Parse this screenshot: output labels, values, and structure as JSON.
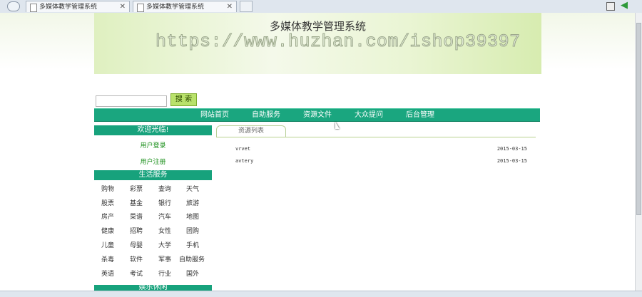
{
  "browser": {
    "tabs": [
      {
        "label": "多媒体教学管理系统"
      },
      {
        "label": "多媒体教学管理系统"
      }
    ]
  },
  "site": {
    "title": "多媒体教学管理系统",
    "watermark": "https://www.huzhan.com/ishop39397"
  },
  "search": {
    "value": "",
    "button_label": "搜 索"
  },
  "nav": {
    "items": [
      {
        "label": "网站首页"
      },
      {
        "label": "自助服务"
      },
      {
        "label": "资源文件"
      },
      {
        "label": "大众提问"
      },
      {
        "label": "后台管理"
      }
    ]
  },
  "sidebar": {
    "welcome_title": "欢迎光临!",
    "login_link": "用户登录",
    "register_link": "用户注册",
    "life_title": "生活服务",
    "life_items": [
      [
        "购物",
        "彩票",
        "查询",
        "天气"
      ],
      [
        "股票",
        "基金",
        "银行",
        "旅游"
      ],
      [
        "房产",
        "菜谱",
        "汽车",
        "地图"
      ],
      [
        "健康",
        "招聘",
        "女性",
        "团购"
      ],
      [
        "儿童",
        "母婴",
        "大学",
        "手机"
      ],
      [
        "杀毒",
        "软件",
        "军事",
        "自助服务"
      ],
      [
        "英语",
        "考试",
        "行业",
        "国外"
      ]
    ],
    "fun_title": "娱乐休闲"
  },
  "main": {
    "tab_label": "资源列表",
    "resources": [
      {
        "name": "vrvet",
        "date": "2015-03-15"
      },
      {
        "name": "avtery",
        "date": "2015-03-15"
      }
    ]
  }
}
